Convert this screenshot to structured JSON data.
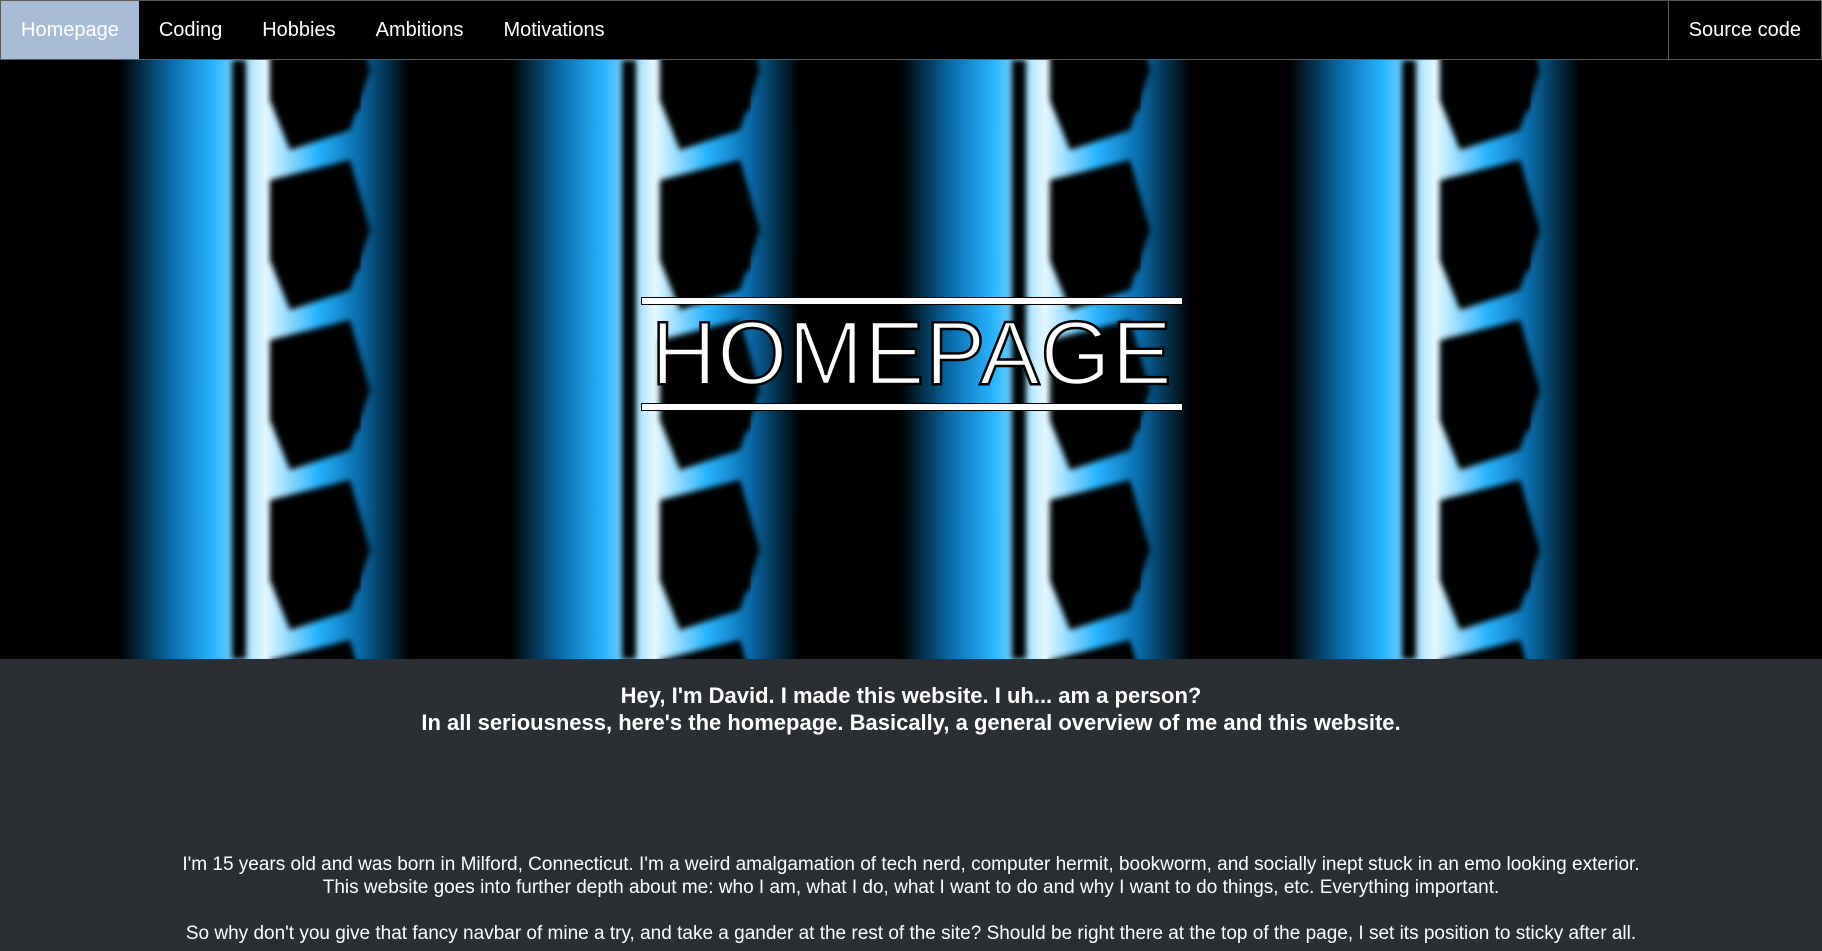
{
  "nav": {
    "items": [
      {
        "label": "Homepage",
        "active": true
      },
      {
        "label": "Coding",
        "active": false
      },
      {
        "label": "Hobbies",
        "active": false
      },
      {
        "label": "Ambitions",
        "active": false
      },
      {
        "label": "Motivations",
        "active": false
      }
    ],
    "source_code": "Source code",
    "active_color": "#a9bcd6"
  },
  "hero": {
    "title": "HOMEPAGE",
    "glow_color": "#1aa7ff",
    "highlight_color": "#e6f8ff"
  },
  "content": {
    "intro_line1": "Hey, I'm David. I made this website. I uh... am a person?",
    "intro_line2": "In all seriousness, here's the homepage. Basically, a general overview of me and this website.",
    "para1_line1": "I'm 15 years old and was born in Milford, Connecticut. I'm a weird amalgamation of tech nerd, computer hermit, bookworm, and socially inept stuck in an emo looking exterior.",
    "para1_line2": "This website goes into further depth about me: who I am, what I do, what I want to do and why I want to do things, etc. Everything important.",
    "para2": "So why don't you give that fancy navbar of mine a try, and take a gander at the rest of the site? Should be right there at the top of the page, I set its position to sticky after all."
  }
}
